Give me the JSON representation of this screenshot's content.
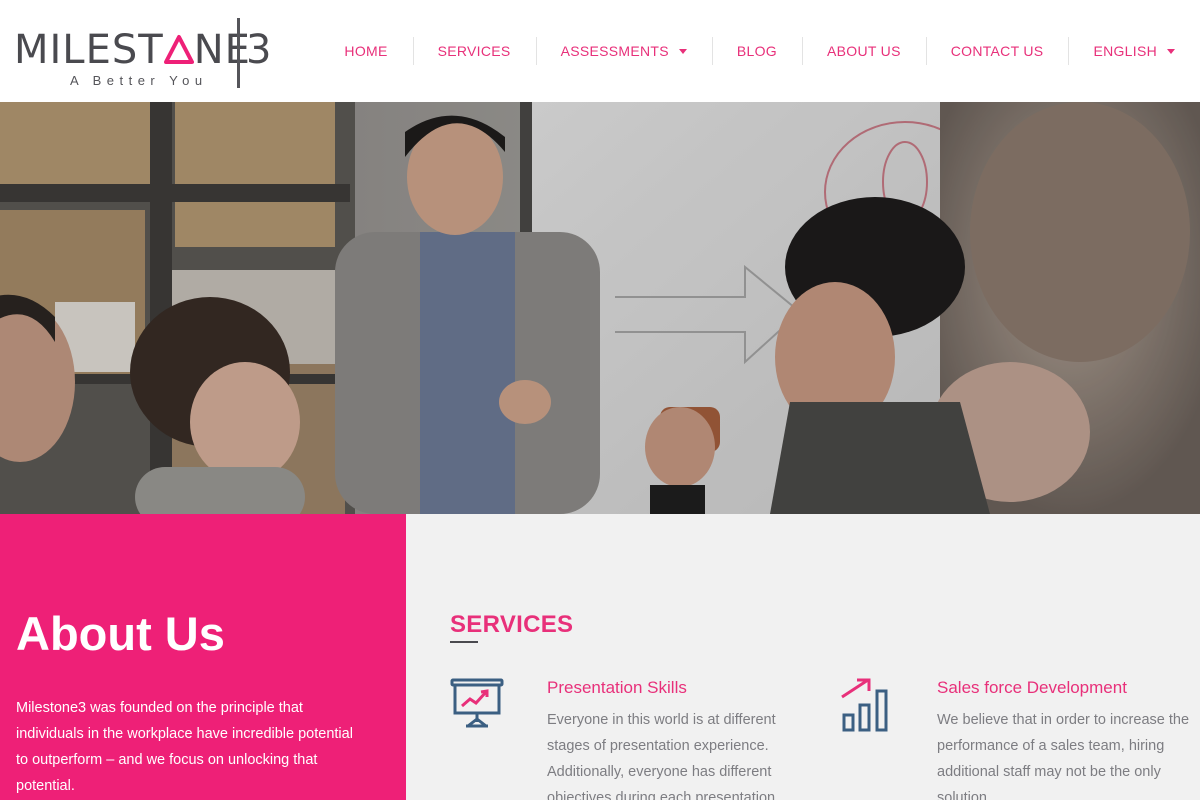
{
  "brand": {
    "name_prefix": "MILEST",
    "name_suffix": "NE",
    "number": "3",
    "tagline": "A Better You",
    "text_color": "#4a4a4f"
  },
  "nav": {
    "items": [
      {
        "label": "HOME"
      },
      {
        "label": "SERVICES"
      },
      {
        "label": "ASSESSMENTS",
        "has_dropdown": true
      },
      {
        "label": "BLOG"
      },
      {
        "label": "ABOUT US"
      },
      {
        "label": "CONTACT US"
      },
      {
        "label": "ENGLISH",
        "has_dropdown": true
      }
    ],
    "color": "#e8307a"
  },
  "hero": {
    "image": "office-meeting-photo"
  },
  "about": {
    "title": "About Us",
    "text": "Milestone3 was founded on the principle that individuals in the workplace have incredible potential to outperform – and we focus on unlocking that potential.",
    "background": "#ee2077"
  },
  "services": {
    "title": "SERVICES",
    "items": [
      {
        "name": "Presentation Skills",
        "icon": "presentation-board-icon",
        "description": "Everyone in this world is at different stages of presentation experience. Additionally, everyone has different objectives during each presentation."
      },
      {
        "name": "Sales force Development",
        "icon": "growth-chart-icon",
        "description": "We believe that in order to increase the performance of a sales team, hiring additional staff may not be the only solution."
      }
    ],
    "accent": "#e8307a",
    "icon_color": "#3b5f82"
  }
}
